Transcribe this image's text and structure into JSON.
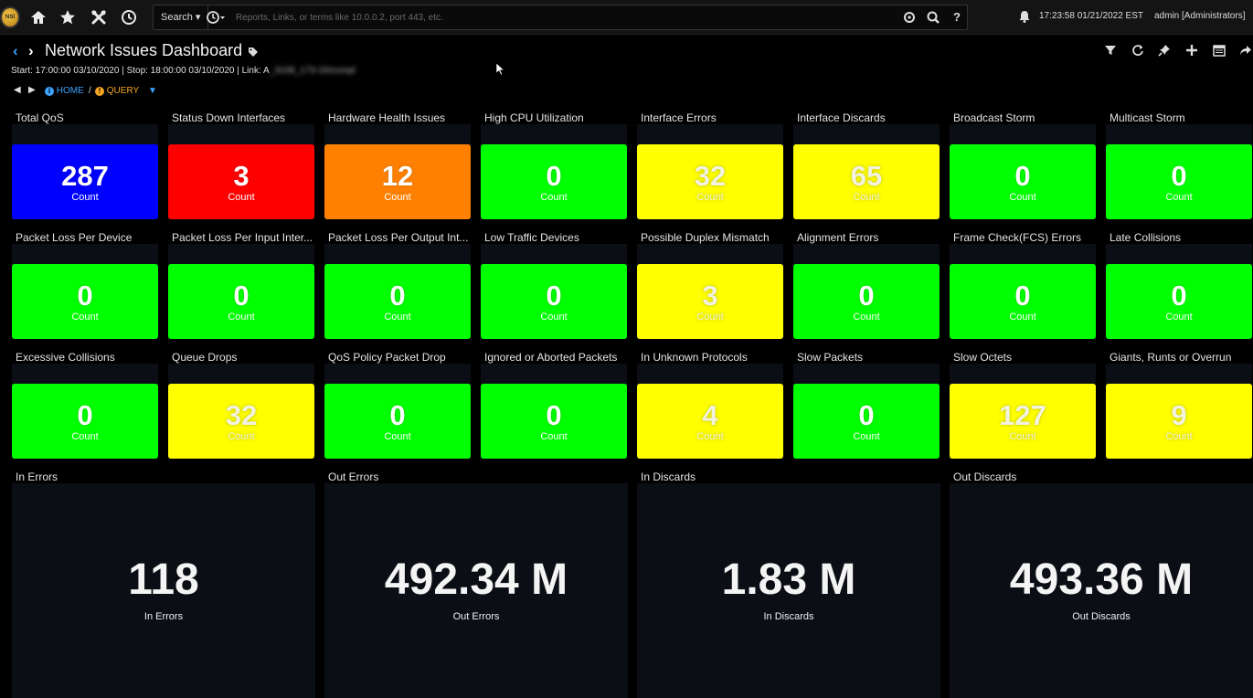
{
  "topbar": {
    "logo_text": "NSI",
    "search_label": "Search",
    "search_placeholder": "Reports, Links, or terms like 10.0.0.2, port 443, etc.",
    "datetime": "17:23:58 01/21/2022 EST",
    "user": "admin [Administrators]"
  },
  "header": {
    "title": "Network Issues Dashboard",
    "range": "Start: 17:00:00 03/10/2020 | Stop: 18:00:00 03/10/2020 | Link: A",
    "link_blurred": "_3108_173-16/compl",
    "breadcrumb_home": "HOME",
    "breadcrumb_sep": "/",
    "breadcrumb_query": "QUERY"
  },
  "colors": {
    "blue": "#0000ff",
    "red": "#ff0000",
    "orange": "#ff8000",
    "green": "#00ff00",
    "yellow": "#ffff00",
    "panel": "#0b0e14"
  },
  "tiles": [
    {
      "title": "Total QoS",
      "value": "287",
      "unit": "Count",
      "color": "blue"
    },
    {
      "title": "Status Down Interfaces",
      "value": "3",
      "unit": "Count",
      "color": "red"
    },
    {
      "title": "Hardware Health Issues",
      "value": "12",
      "unit": "Count",
      "color": "orange"
    },
    {
      "title": "High CPU Utilization",
      "value": "0",
      "unit": "Count",
      "color": "green"
    },
    {
      "title": "Interface Errors",
      "value": "32",
      "unit": "Count",
      "color": "yellow"
    },
    {
      "title": "Interface Discards",
      "value": "65",
      "unit": "Count",
      "color": "yellow"
    },
    {
      "title": "Broadcast Storm",
      "value": "0",
      "unit": "Count",
      "color": "green"
    },
    {
      "title": "Multicast Storm",
      "value": "0",
      "unit": "Count",
      "color": "green"
    },
    {
      "title": "Packet Loss Per Device",
      "value": "0",
      "unit": "Count",
      "color": "green"
    },
    {
      "title": "Packet Loss Per Input Inter...",
      "value": "0",
      "unit": "Count",
      "color": "green"
    },
    {
      "title": "Packet Loss Per Output Int...",
      "value": "0",
      "unit": "Count",
      "color": "green"
    },
    {
      "title": "Low Traffic Devices",
      "value": "0",
      "unit": "Count",
      "color": "green"
    },
    {
      "title": "Possible Duplex Mismatch",
      "value": "3",
      "unit": "Count",
      "color": "yellow"
    },
    {
      "title": "Alignment Errors",
      "value": "0",
      "unit": "Count",
      "color": "green"
    },
    {
      "title": "Frame Check(FCS) Errors",
      "value": "0",
      "unit": "Count",
      "color": "green"
    },
    {
      "title": "Late Collisions",
      "value": "0",
      "unit": "Count",
      "color": "green"
    },
    {
      "title": "Excessive Collisions",
      "value": "0",
      "unit": "Count",
      "color": "green"
    },
    {
      "title": "Queue Drops",
      "value": "32",
      "unit": "Count",
      "color": "yellow"
    },
    {
      "title": "QoS Policy Packet Drop",
      "value": "0",
      "unit": "Count",
      "color": "green"
    },
    {
      "title": "Ignored or Aborted Packets",
      "value": "0",
      "unit": "Count",
      "color": "green"
    },
    {
      "title": "In Unknown Protocols",
      "value": "4",
      "unit": "Count",
      "color": "yellow"
    },
    {
      "title": "Slow Packets",
      "value": "0",
      "unit": "Count",
      "color": "green"
    },
    {
      "title": "Slow Octets",
      "value": "127",
      "unit": "Count",
      "color": "yellow"
    },
    {
      "title": "Giants, Runts or Overrun",
      "value": "9",
      "unit": "Count",
      "color": "yellow"
    }
  ],
  "big_panels": [
    {
      "title": "In Errors",
      "value": "118",
      "unit": "In Errors"
    },
    {
      "title": "Out Errors",
      "value": "492.34 M",
      "unit": "Out Errors"
    },
    {
      "title": "In Discards",
      "value": "1.83 M",
      "unit": "In Discards"
    },
    {
      "title": "Out Discards",
      "value": "493.36 M",
      "unit": "Out Discards"
    }
  ]
}
